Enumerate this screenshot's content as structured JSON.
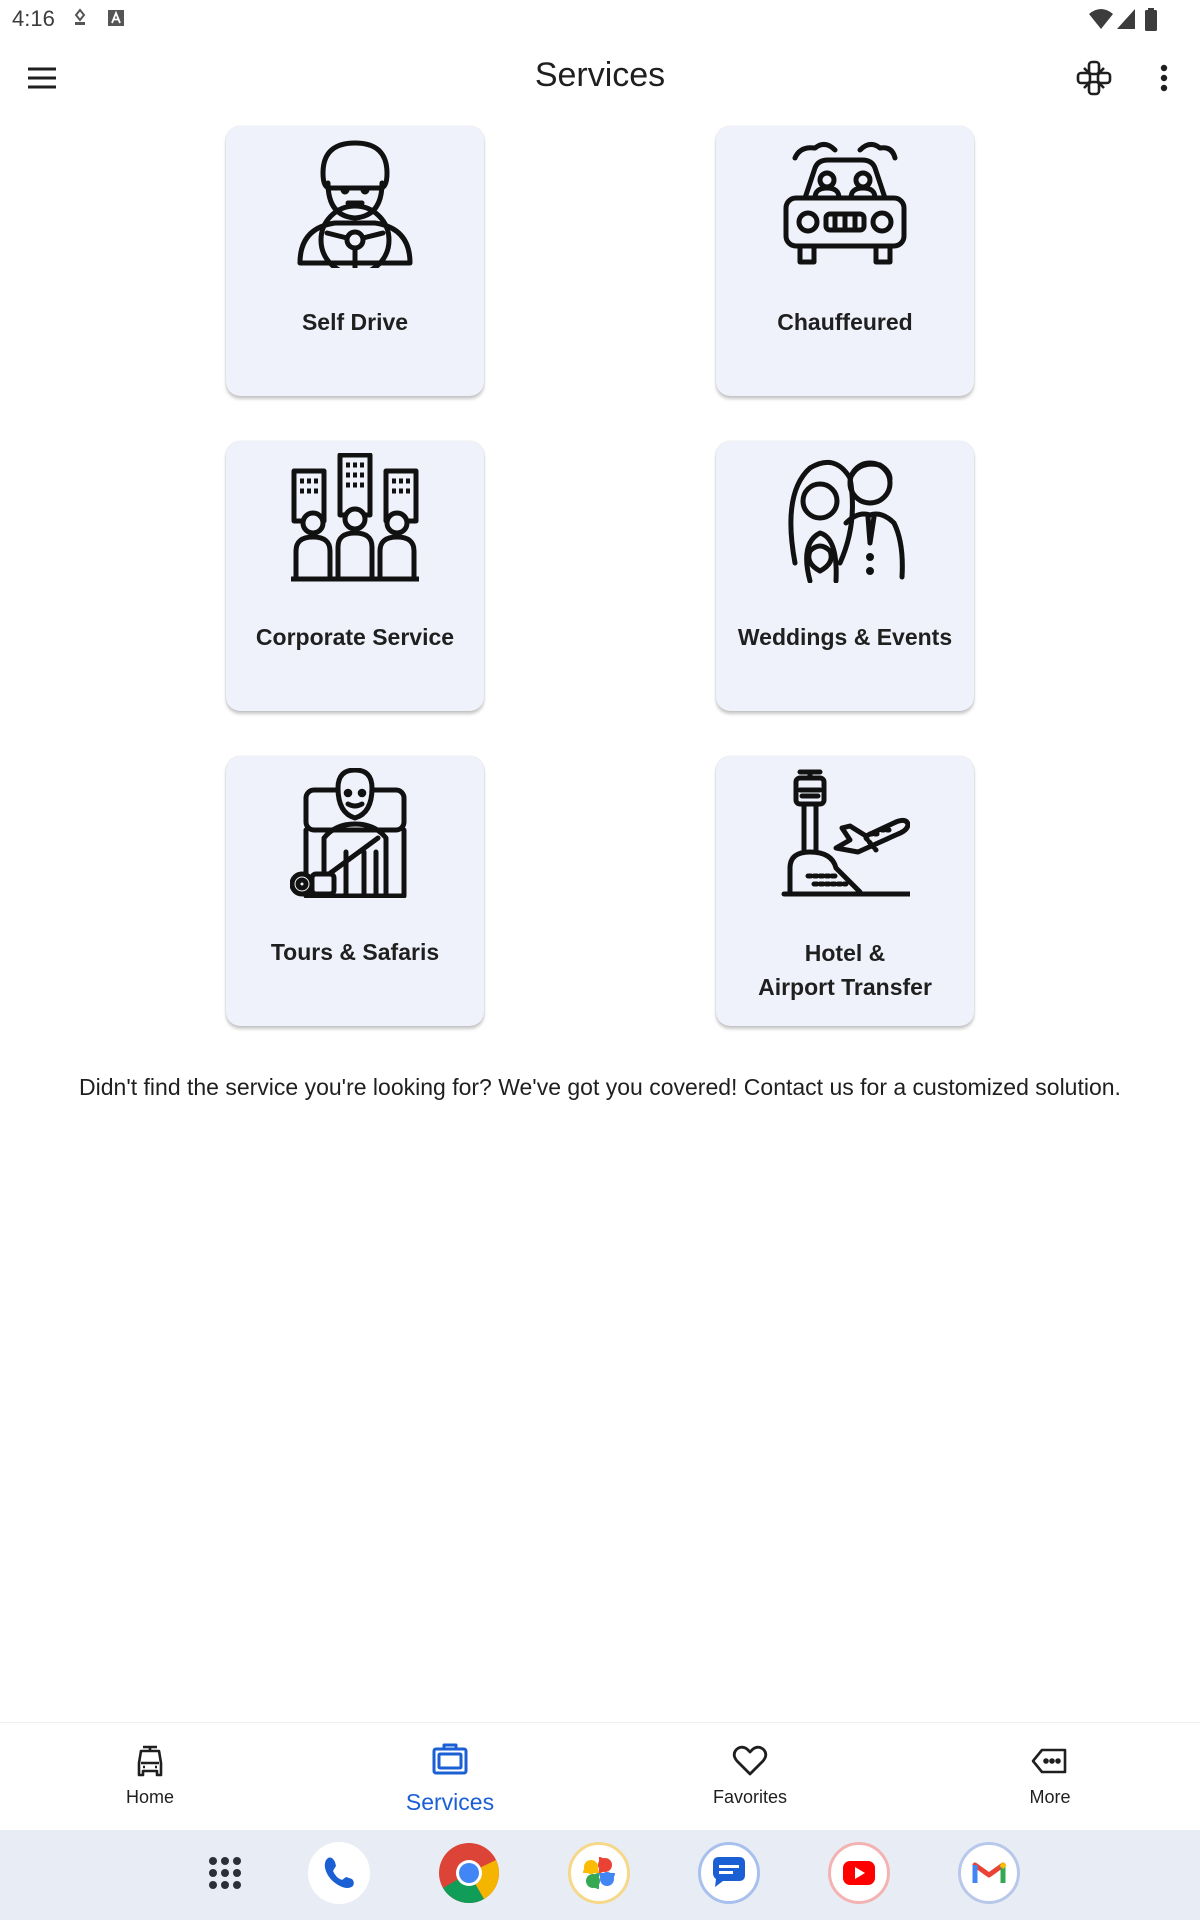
{
  "status_bar": {
    "time": "4:16"
  },
  "app_bar": {
    "title": "Services"
  },
  "services": [
    {
      "label": "Self Drive",
      "icon": "steering-driver-icon"
    },
    {
      "label": "Chauffeured",
      "icon": "chauffeur-car-icon"
    },
    {
      "label": "Corporate Service",
      "icon": "corporate-people-icon"
    },
    {
      "label": "Weddings & Events",
      "icon": "wedding-couple-icon"
    },
    {
      "label": "Tours & Safaris",
      "icon": "tourist-camera-icon"
    },
    {
      "label_line1": "Hotel &",
      "label_line2": "Airport Transfer",
      "icon": "airport-plane-icon"
    }
  ],
  "info": {
    "text": "Didn't find the service you're looking for? We've got you covered! Contact us for a customized solution."
  },
  "bottom_nav": {
    "items": [
      {
        "label": "Home",
        "icon": "car-icon"
      },
      {
        "label": "Services",
        "icon": "briefcase-icon",
        "active": true
      },
      {
        "label": "Favorites",
        "icon": "heart-icon"
      },
      {
        "label": "More",
        "icon": "more-tag-icon"
      }
    ]
  },
  "dock": {
    "apps": [
      "app-drawer",
      "phone",
      "chrome",
      "photos",
      "messages",
      "youtube",
      "gmail"
    ]
  },
  "colors": {
    "accent": "#1a5fd3",
    "card_bg": "#eff2fa"
  }
}
